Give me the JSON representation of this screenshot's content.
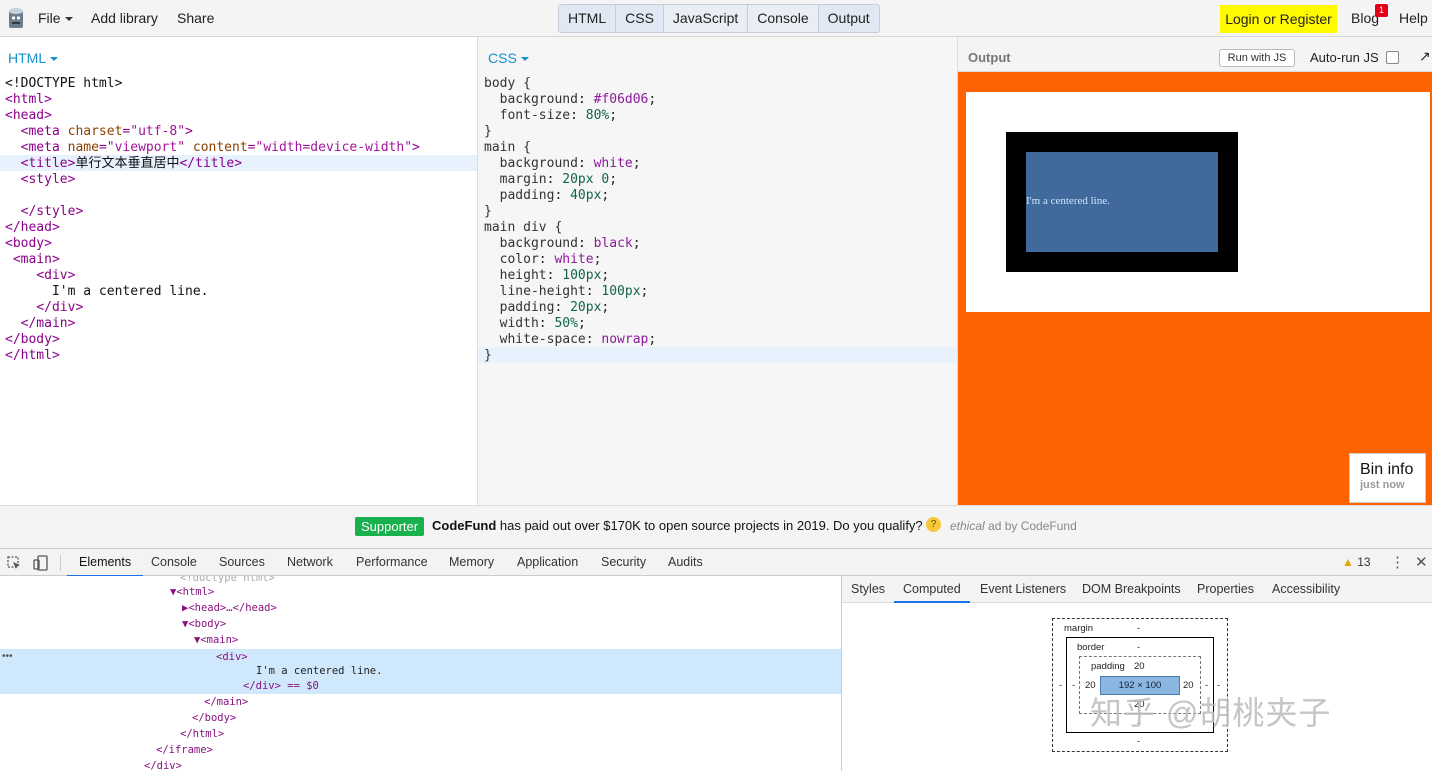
{
  "topbar": {
    "file": "File",
    "add_library": "Add library",
    "share": "Share",
    "tabs": [
      "HTML",
      "CSS",
      "JavaScript",
      "Console",
      "Output"
    ],
    "login": "Login or Register",
    "blog": "Blog",
    "blog_badge": "1",
    "help": "Help"
  },
  "html_panel": {
    "title": "HTML",
    "lines": [
      "<!DOCTYPE html>",
      "<html>",
      "<head>",
      "  <meta charset=\"utf-8\">",
      "  <meta name=\"viewport\" content=\"width=device-width\">",
      "  <title>单行文本垂直居中</title>",
      "  <style>",
      "",
      "  </style>",
      "</head>",
      "<body>",
      " <main>",
      "    <div>",
      "      I'm a centered line.",
      "    </div>",
      "  </main>",
      "</body>",
      "</html>"
    ]
  },
  "css_panel": {
    "title": "CSS",
    "lines": [
      "body {",
      "  background: #f06d06;",
      "  font-size: 80%;",
      "}",
      "main {",
      "  background: white;",
      "  margin: 20px 0;",
      "  padding: 40px;",
      "}",
      "main div {",
      "  background: black;",
      "  color: white;",
      "  height: 100px;",
      "  line-height: 100px;",
      "  padding: 20px;",
      "  width: 50%;",
      "  white-space: nowrap;",
      "}"
    ]
  },
  "output_panel": {
    "title": "Output",
    "run_js": "Run with JS",
    "auto_run": "Auto-run JS",
    "rendered_text": "I'm a centered line.",
    "bin_info": "Bin info",
    "bin_time": "just now",
    "bg_color": "#ff6200"
  },
  "ad": {
    "badge": "Supporter",
    "brand": "CodeFund",
    "message": " has paid out over $170K to open source projects in 2019. Do you qualify?",
    "ethical": "ethical",
    "by": " ad by CodeFund"
  },
  "devtools": {
    "tabs": [
      "Elements",
      "Console",
      "Sources",
      "Network",
      "Performance",
      "Memory",
      "Application",
      "Security",
      "Audits"
    ],
    "warnings": "13",
    "dom": [
      "<!doctype html>",
      "▼<html>",
      "▶<head>…</head>",
      "▼<body>",
      "▼<main>",
      "<div>",
      "I'm a centered line.",
      "</div> == $0",
      "</main>",
      "</body>",
      "</html>",
      "</iframe>",
      "</div>"
    ],
    "side_tabs": [
      "Styles",
      "Computed",
      "Event Listeners",
      "DOM Breakpoints",
      "Properties",
      "Accessibility"
    ],
    "box_model": {
      "margin_label": "margin",
      "margin_val": "-",
      "border_label": "border",
      "border_val": "-",
      "padding_label": "padding",
      "padding_top": "20",
      "padding_left": "20",
      "padding_right": "20",
      "padding_bottom": "20",
      "content": "192 × 100",
      "dash": "-"
    }
  },
  "watermark": "知乎 @胡桃夹子"
}
